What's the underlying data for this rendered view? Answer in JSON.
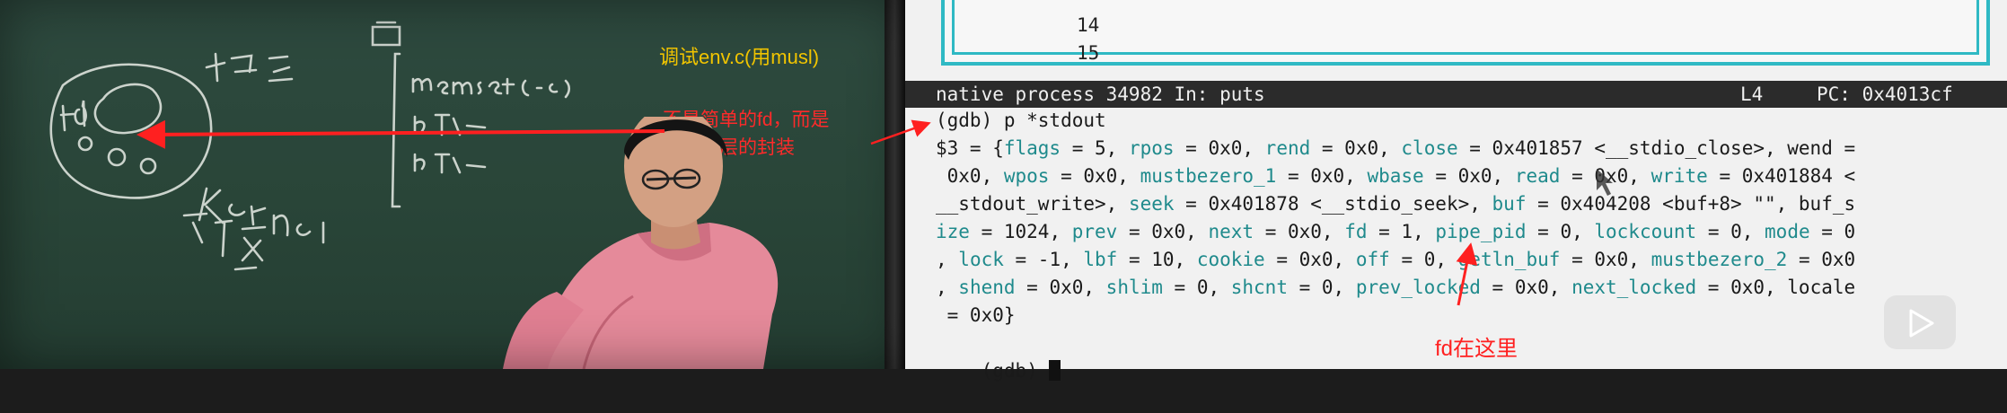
{
  "board": {
    "debug_label": "调试env.c(用musl)",
    "wrap_note_line1": "不是简单的fd，而是",
    "wrap_note_line2": "做了一层的封装",
    "colors": {
      "debug_label": "#f2c500",
      "annotation": "#ff2a2a",
      "chalk": "#e8ece6"
    }
  },
  "terminal": {
    "source_lines": [
      "14",
      "15"
    ],
    "status_bar": {
      "process": "native process 34982 In: puts",
      "line": "L4",
      "pc": "PC: 0x4013cf"
    },
    "command": "(gdb) p *stdout",
    "output_lines": [
      "$3 = {flags = 5, rpos = 0x0, rend = 0x0, close = 0x401857 <__stdio_close>, wend =",
      " 0x0, wpos = 0x0, mustbezero_1 = 0x0, wbase = 0x0, read = 0x0, write = 0x401884 <",
      "__stdout_write>, seek = 0x401878 <__stdio_seek>, buf = 0x404208 <buf+8> \"\", buf_s",
      "ize = 1024, prev = 0x0, next = 0x0, fd = 1, pipe_pid = 0, lockcount = 0, mode = 0",
      ", lock = -1, lbf = 10, cookie = 0x0, off = 0, getln_buf = 0x0, mustbezero_2 = 0x0",
      ", shend = 0x0, shlim = 0, shcnt = 0, prev_locked = 0x0, next_locked = 0x0, locale",
      " = 0x0}"
    ],
    "prompt": "(gdb) ",
    "colors": {
      "border": "#2fb9c4",
      "field": "#1f8a8c",
      "status_bg": "#2b2b2b"
    }
  },
  "annotation": {
    "fd_note": "fd在这里"
  },
  "player": {
    "play_icon": "play-icon"
  }
}
